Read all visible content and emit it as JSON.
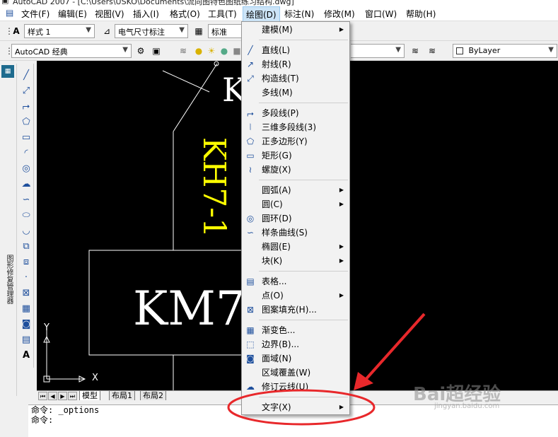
{
  "app": {
    "title": "AutoCAD 2007 - [C:\\Users\\USKO\\Documents\\流向图特色图纸练习结构.dwg]"
  },
  "menubar": {
    "items": [
      "文件(F)",
      "编辑(E)",
      "视图(V)",
      "插入(I)",
      "格式(O)",
      "工具(T)",
      "绘图(D)",
      "标注(N)",
      "修改(M)",
      "窗口(W)",
      "帮助(H)"
    ],
    "open_index": 6
  },
  "toolbar1": {
    "text_style": "样式 1",
    "dim_style": "电气尺寸标注",
    "table_style": "标准"
  },
  "toolbar2": {
    "workspace": "AutoCAD 经典",
    "linetype": "ByLayer"
  },
  "left_panel": {
    "title": "图形修复管理器"
  },
  "drawing": {
    "text_km7": "KM7",
    "text_kh71": "KH7-1",
    "text_k": "K",
    "axis_y": "Y",
    "axis_x": "X"
  },
  "layout_tabs": [
    "模型",
    "布局1",
    "布局2"
  ],
  "command": {
    "lines": [
      "命令: _options",
      "命令:"
    ]
  },
  "draw_menu": {
    "items": [
      {
        "label": "建模(M)",
        "icon": "none",
        "submenu": true
      },
      {
        "sep": true
      },
      {
        "label": "直线(L)",
        "icon": "line-icon"
      },
      {
        "label": "射线(R)",
        "icon": "ray-icon"
      },
      {
        "label": "构造线(T)",
        "icon": "construction-line-icon"
      },
      {
        "label": "多线(M)",
        "icon": "none"
      },
      {
        "sep": true
      },
      {
        "label": "多段线(P)",
        "icon": "polyline-icon"
      },
      {
        "label": "三维多段线(3)",
        "icon": "3d-polyline-icon"
      },
      {
        "label": "正多边形(Y)",
        "icon": "polygon-icon"
      },
      {
        "label": "矩形(G)",
        "icon": "rectangle-icon"
      },
      {
        "label": "螺旋(X)",
        "icon": "helix-icon"
      },
      {
        "sep": true
      },
      {
        "label": "圆弧(A)",
        "icon": "none",
        "submenu": true
      },
      {
        "label": "圆(C)",
        "icon": "none",
        "submenu": true
      },
      {
        "label": "圆环(D)",
        "icon": "donut-icon"
      },
      {
        "label": "样条曲线(S)",
        "icon": "spline-icon"
      },
      {
        "label": "椭圆(E)",
        "icon": "none",
        "submenu": true
      },
      {
        "label": "块(K)",
        "icon": "none",
        "submenu": true
      },
      {
        "sep": true
      },
      {
        "label": "表格...",
        "icon": "table-icon"
      },
      {
        "label": "点(O)",
        "icon": "none",
        "submenu": true
      },
      {
        "label": "图案填充(H)...",
        "icon": "hatch-icon"
      },
      {
        "sep": true
      },
      {
        "label": "渐变色...",
        "icon": "gradient-icon"
      },
      {
        "label": "边界(B)...",
        "icon": "boundary-icon"
      },
      {
        "label": "面域(N)",
        "icon": "region-icon"
      },
      {
        "label": "区域覆盖(W)",
        "icon": "none"
      },
      {
        "label": "修订云线(U)",
        "icon": "revcloud-icon"
      },
      {
        "sep": true
      },
      {
        "label": "文字(X)",
        "icon": "none",
        "submenu": true
      }
    ]
  },
  "watermark": {
    "text": "Bai超经验",
    "url": "jingyan.baidu.com"
  },
  "annotation": {
    "color": "#e8282b"
  }
}
